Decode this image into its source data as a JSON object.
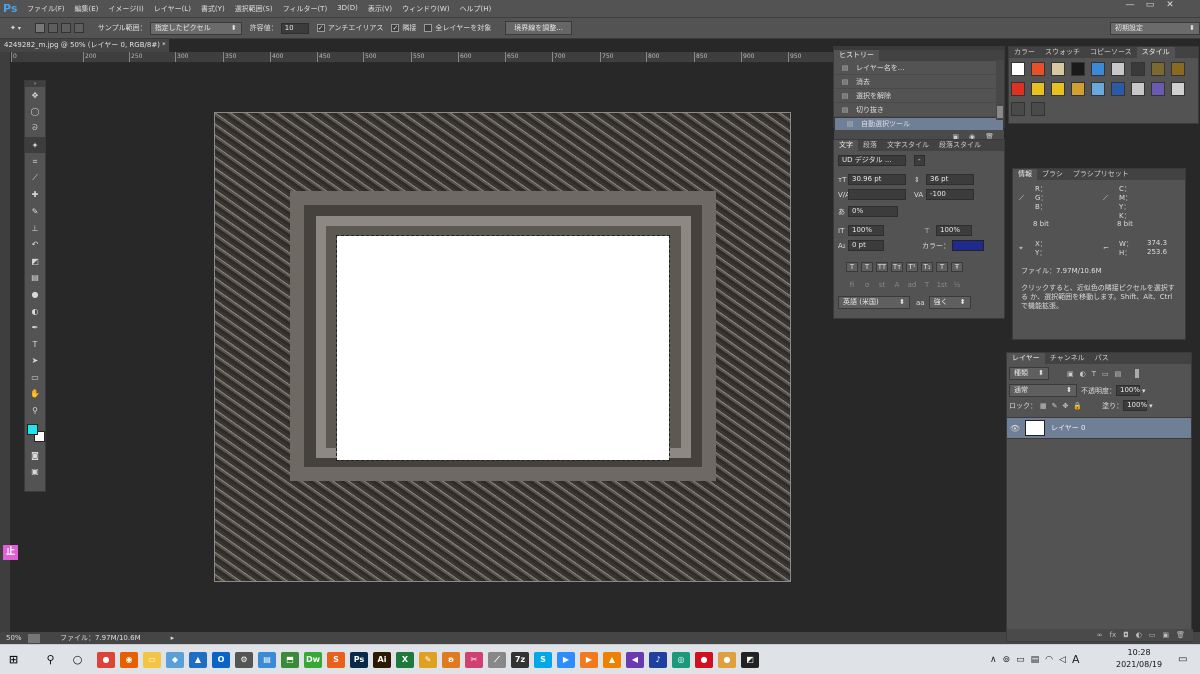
{
  "app": {
    "logo": "Ps"
  },
  "menu": [
    "ファイル(F)",
    "編集(E)",
    "イメージ(I)",
    "レイヤー(L)",
    "書式(Y)",
    "選択範囲(S)",
    "フィルター(T)",
    "3D(D)",
    "表示(V)",
    "ウィンドウ(W)",
    "ヘルプ(H)"
  ],
  "window_controls": [
    "—",
    "▭",
    "✕"
  ],
  "options": {
    "sample_label": "サンプル範囲：",
    "sample_value": "指定したピクセル",
    "tolerance_label": "許容値：",
    "tolerance_value": "10",
    "antialias_label": "アンチエイリアス",
    "contiguous_label": "隣接",
    "all_layers_label": "全レイヤーを対象",
    "refine_button": "境界線を調整...",
    "workspace": "初期設定"
  },
  "document": {
    "tab_title": "4249282_m.jpg @ 50% (レイヤー 0, RGB/8#) *",
    "close": "×"
  },
  "ruler_top_ticks": [
    "0",
    "200",
    "250",
    "300",
    "350",
    "400",
    "450",
    "500",
    "550",
    "600",
    "650",
    "700",
    "750",
    "800",
    "850",
    "900",
    "950",
    "1000",
    "1050",
    "1100"
  ],
  "status": {
    "zoom": "50%",
    "file_info": "ファイル：7.97M/10.6M"
  },
  "history": {
    "tab": "ヒストリー",
    "items": [
      {
        "label": "レイヤー名を...",
        "selected": false
      },
      {
        "label": "消去",
        "selected": false
      },
      {
        "label": "選択を解除",
        "selected": false
      },
      {
        "label": "切り抜き",
        "selected": false
      },
      {
        "label": "自動選択ツール",
        "selected": true
      }
    ]
  },
  "character": {
    "tabs": [
      "文字",
      "段落",
      "文字スタイル",
      "段落スタイル"
    ],
    "font_family": "UD デジタル ...",
    "font_style": "-",
    "font_size": "30.96 pt",
    "leading": "36 pt",
    "kerning": "",
    "tracking": "-100",
    "tsume": "0%",
    "vscale": "100%",
    "hscale": "100%",
    "baseline": "0 pt",
    "color_label": "カラー：",
    "color": "#1f2b8c",
    "style_buttons": [
      "T",
      "T",
      "TT",
      "Tт",
      "T¹",
      "T₁",
      "T",
      "Ŧ"
    ],
    "opentype_buttons": [
      "fi",
      "σ",
      "st",
      "A",
      "ad",
      "T",
      "1st",
      "½"
    ],
    "language": "英語 (米国)",
    "aa_label": "aa",
    "antialias": "強く"
  },
  "color_panel": {
    "tabs": [
      "カラー",
      "スウォッチ",
      "コピーソース",
      "スタイル"
    ]
  },
  "info": {
    "tabs": [
      "情報",
      "ブラシ",
      "ブラシプリセット"
    ],
    "rgb_labels": [
      "R：",
      "G：",
      "B："
    ],
    "cmyk_labels": [
      "C：",
      "M：",
      "Y：",
      "K："
    ],
    "bit_left": "8 bit",
    "bit_right": "8 bit",
    "x_label": "X：",
    "y_label": "Y：",
    "w_label": "W：",
    "h_label": "H：",
    "w_value": "374.3",
    "h_value": "253.6",
    "file": "ファイル：7.97M/10.6M",
    "help": "クリックすると、近似色の隣接ピクセルを選択する か、選択範囲を移動します。Shift、Alt、Ctrl で機能拡張。"
  },
  "layers": {
    "tabs": [
      "レイヤー",
      "チャンネル",
      "パス"
    ],
    "kind": "種類",
    "blend": "通常",
    "opacity_label": "不透明度：",
    "opacity": "100%",
    "lock_label": "ロック：",
    "fill_label": "塗り：",
    "fill": "100%",
    "layer_name": "レイヤー 0"
  },
  "taskbar": {
    "time": "10:28",
    "date": "2021/08/19",
    "ime": "A"
  },
  "badge": "止"
}
